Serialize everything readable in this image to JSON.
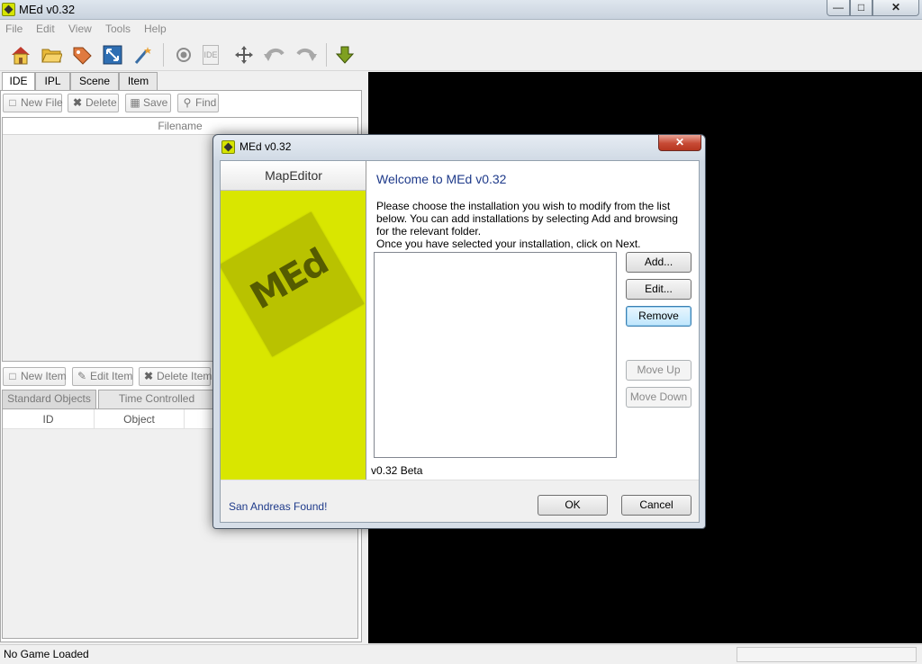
{
  "window": {
    "title": "MEd v0.32",
    "min_glyph": "—",
    "max_glyph": "□",
    "close_glyph": "✕"
  },
  "menu": [
    "File",
    "Edit",
    "View",
    "Tools",
    "Help"
  ],
  "toolbar_icons": [
    "home-icon",
    "open-folder-icon",
    "tag-icon",
    "resize-icon",
    "wand-icon",
    "record-icon",
    "ide-icon",
    "move-icon",
    "undo-icon",
    "redo-icon",
    "download-arrow-icon"
  ],
  "toolbar_ide_label": "IDE",
  "tabs": [
    "IDE",
    "IPL",
    "Scene",
    "Item"
  ],
  "file_buttons": {
    "new_file": "New File",
    "delete": "Delete",
    "save": "Save",
    "find": "Find"
  },
  "file_list": {
    "header": "Filename"
  },
  "item_buttons": {
    "new_item": "New Item",
    "edit_item": "Edit Item",
    "delete_item": "Delete Item"
  },
  "object_tabs": [
    "Standard Objects",
    "Time Controlled Objects"
  ],
  "object_columns": [
    "ID",
    "Object"
  ],
  "status": {
    "text": "No Game Loaded"
  },
  "dialog": {
    "title": "MEd v0.32",
    "close_glyph": "✕",
    "sidebar_title": "MapEditor",
    "logo_text": "MEd",
    "welcome": "Welcome to MEd v0.32",
    "description_line1": "Please choose the installation you wish to modify from the list below. You can add installations by selecting Add and browsing for the relevant folder.",
    "description_line2": "Once you have selected your installation, click on Next.",
    "buttons": {
      "add": "Add...",
      "edit": "Edit...",
      "remove": "Remove",
      "move_up": "Move Up",
      "move_down": "Move Down"
    },
    "version": "v0.32 Beta",
    "found_text": "San Andreas Found!",
    "ok": "OK",
    "cancel": "Cancel"
  }
}
